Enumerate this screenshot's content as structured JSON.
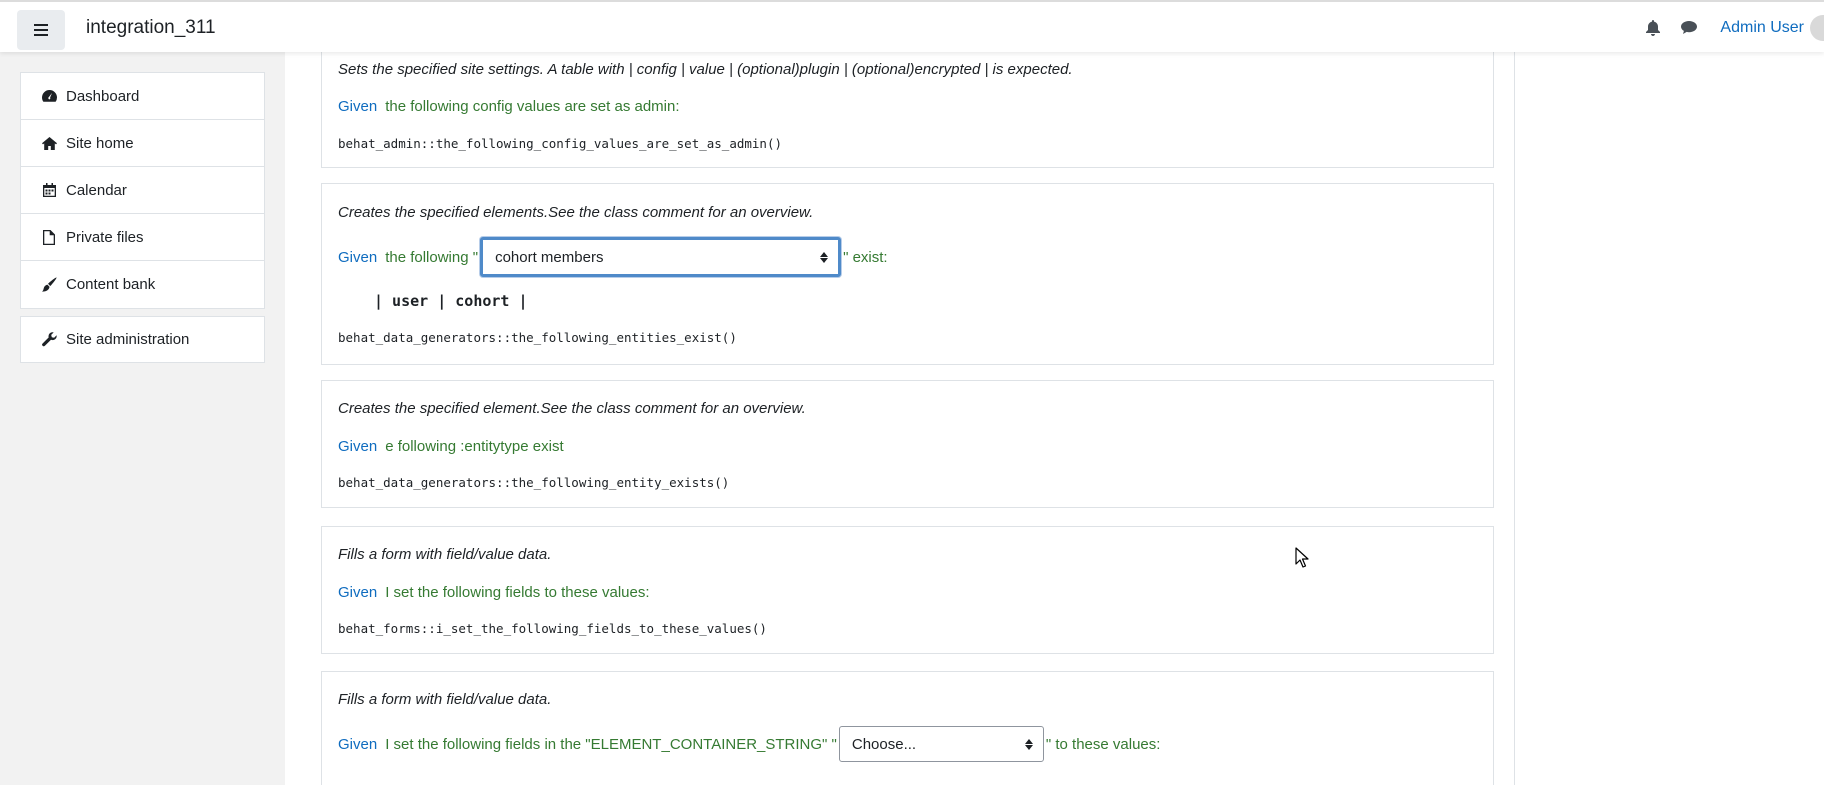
{
  "header": {
    "site_name": "integration_311",
    "user_name": "Admin User",
    "icons": [
      "hamburger-icon",
      "bell-icon",
      "chat-icon"
    ]
  },
  "sidebar": {
    "items": [
      {
        "label": "Dashboard",
        "icon": "dashboard-icon"
      },
      {
        "label": "Site home",
        "icon": "home-icon"
      },
      {
        "label": "Calendar",
        "icon": "calendar-icon"
      },
      {
        "label": "Private files",
        "icon": "file-icon"
      },
      {
        "label": "Content bank",
        "icon": "brush-icon"
      }
    ],
    "admin": {
      "label": "Site administration",
      "icon": "wrench-icon"
    }
  },
  "steps": [
    {
      "description": "Sets the specified site settings. A table with | config | value | (optional)plugin | (optional)encrypted | is expected.",
      "keyword": "Given",
      "text": "the following config values are set as admin:",
      "code": "behat_admin::the_following_config_values_are_set_as_admin()"
    },
    {
      "description": "Creates the specified elements.See the class comment for an overview.",
      "keyword": "Given",
      "text_before": "the following \"",
      "select_value": "cohort members",
      "text_after": "\" exist:",
      "table": "| user | cohort |",
      "code": "behat_data_generators::the_following_entities_exist()"
    },
    {
      "description": "Creates the specified element.See the class comment for an overview.",
      "keyword": "Given",
      "text": "e following :entitytype exist",
      "code": "behat_data_generators::the_following_entity_exists()"
    },
    {
      "description": "Fills a form with field/value data.",
      "keyword": "Given",
      "text": "I set the following fields to these values:",
      "code": "behat_forms::i_set_the_following_fields_to_these_values()"
    },
    {
      "description": "Fills a form with field/value data.",
      "keyword": "Given",
      "text_before": "I set the following fields in the \"ELEMENT_CONTAINER_STRING\" \"",
      "select_value": "Choose...",
      "text_after": "\" to these values:"
    }
  ],
  "colors": {
    "keyword": "#0f6cbf",
    "step_text": "#357a32",
    "focus_ring": "#4f8ac9"
  }
}
